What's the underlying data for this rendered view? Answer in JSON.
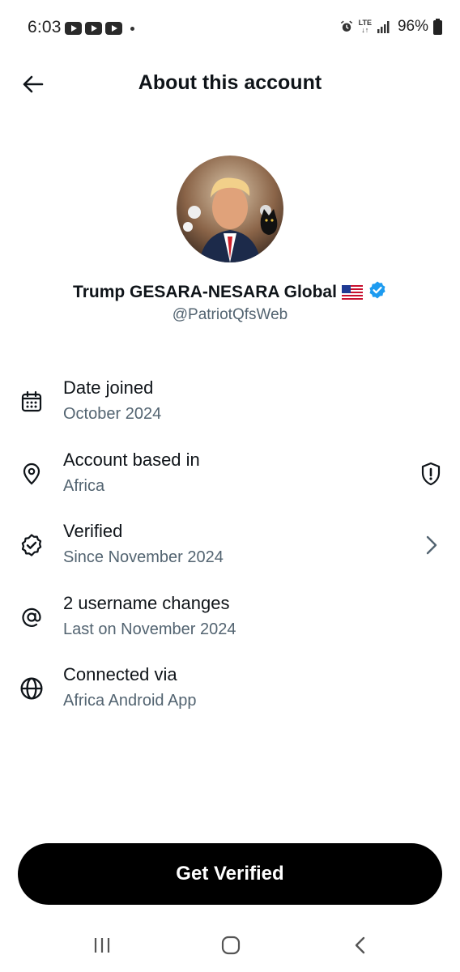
{
  "status_bar": {
    "time": "6:03",
    "network": "LTE",
    "battery": "96%"
  },
  "header": {
    "title": "About this account"
  },
  "profile": {
    "display_name": "Trump GESARA-NESARA Global",
    "handle": "@PatriotQfsWeb",
    "verified_badge_color": "#1d9bf0"
  },
  "info_items": [
    {
      "icon": "calendar-icon",
      "title": "Date joined",
      "subtitle": "October 2024"
    },
    {
      "icon": "location-pin-icon",
      "title": "Account based in",
      "subtitle": "Africa",
      "trailing_icon": "shield-exclamation-icon"
    },
    {
      "icon": "verified-badge-outline-icon",
      "title": "Verified",
      "subtitle": "Since November 2024",
      "trailing_icon": "chevron-right-icon"
    },
    {
      "icon": "at-sign-icon",
      "title": "2 username changes",
      "subtitle": "Last on November 2024"
    },
    {
      "icon": "globe-icon",
      "title": "Connected via",
      "subtitle": "Africa Android App"
    }
  ],
  "cta": {
    "label": "Get Verified"
  },
  "colors": {
    "primary_text": "#0f1419",
    "secondary_text": "#536471",
    "button_bg": "#000000"
  }
}
